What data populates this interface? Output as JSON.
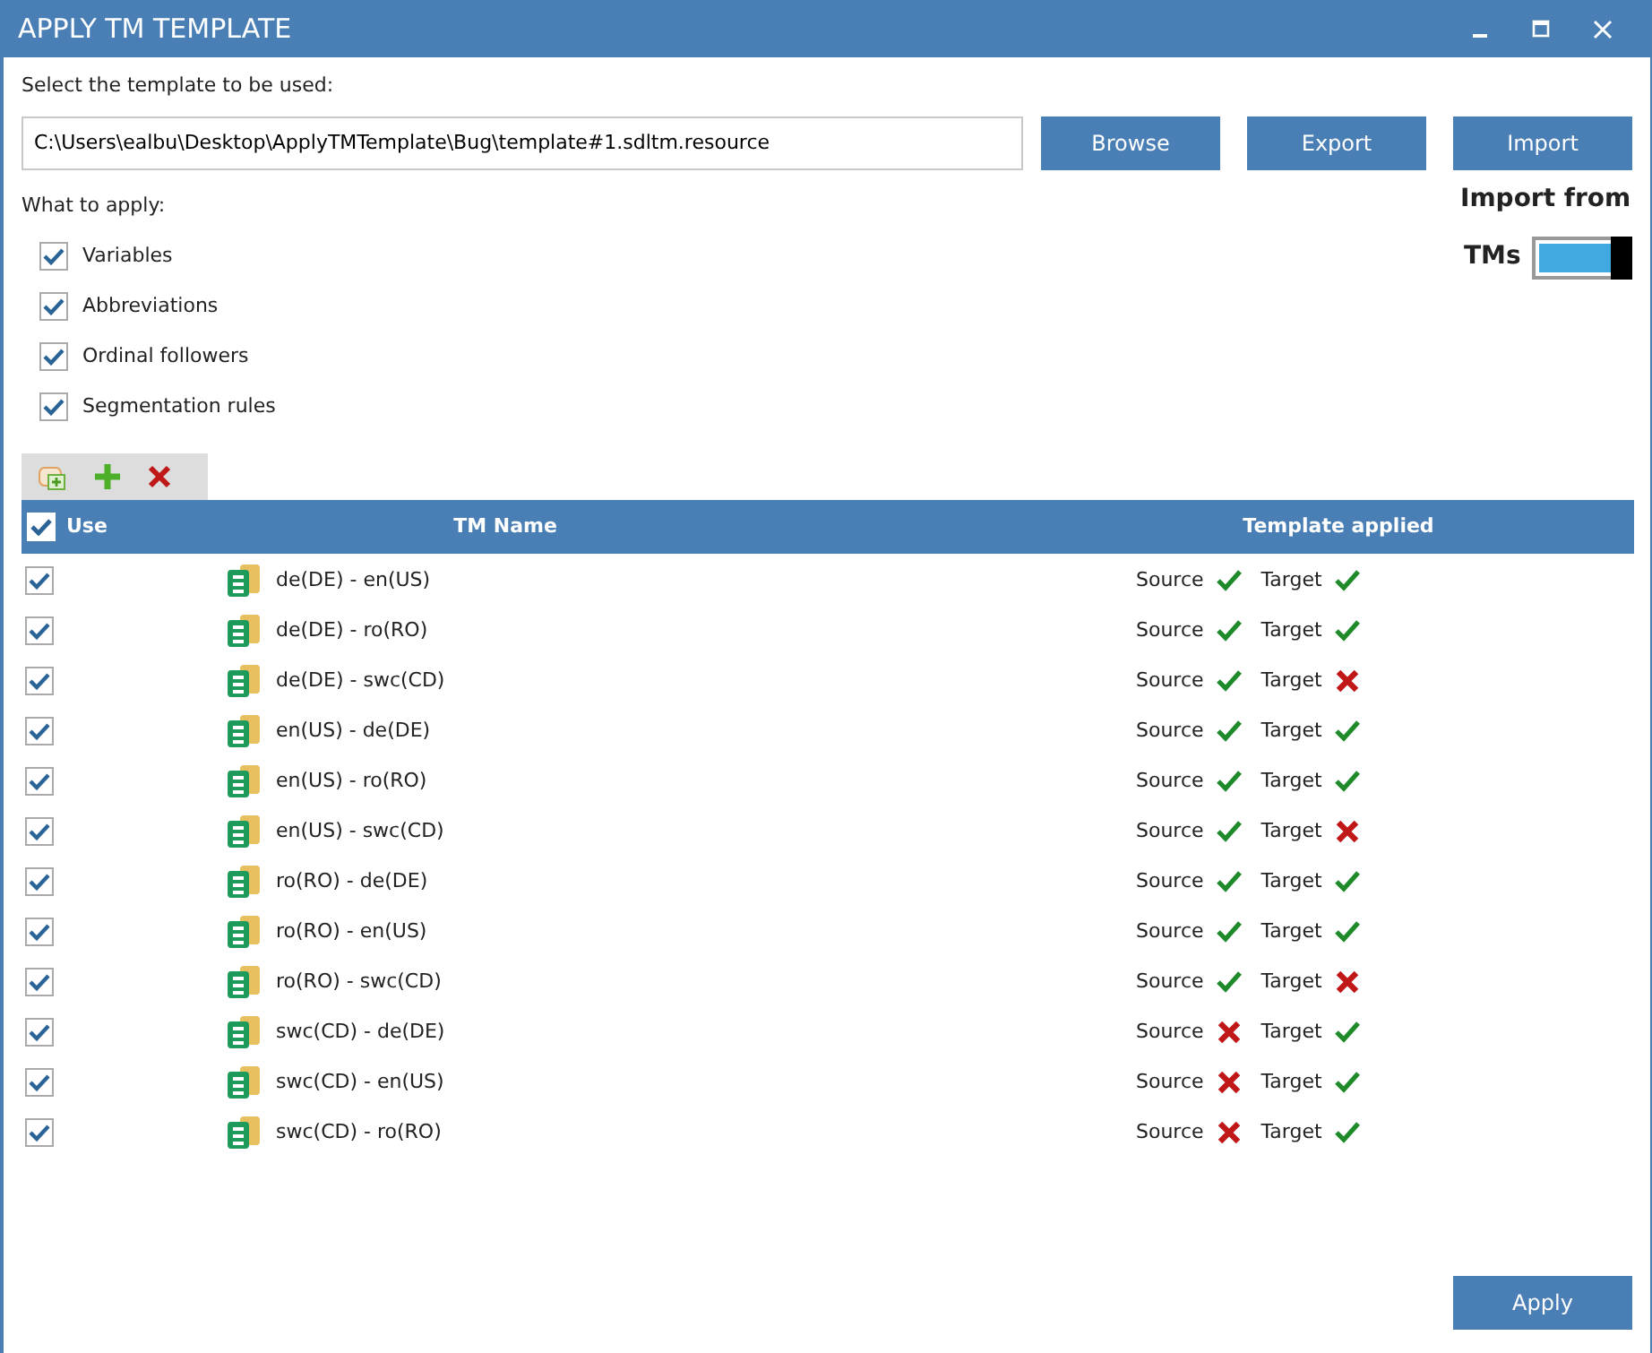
{
  "window": {
    "title": "APPLY TM TEMPLATE"
  },
  "template": {
    "label": "Select the template to be used:",
    "value": "C:\\Users\\ealbu\\Desktop\\ApplyTMTemplate\\Bug\\template#1.sdltm.resource",
    "buttons": [
      "Browse",
      "Export",
      "Import"
    ]
  },
  "import_toggle": {
    "label": "Import from",
    "label_continued": "TMs",
    "on": true
  },
  "apply": {
    "label": "What to apply:",
    "options": [
      {
        "label": "Variables",
        "checked": true
      },
      {
        "label": "Abbreviations",
        "checked": true
      },
      {
        "label": "Ordinal followers",
        "checked": true
      },
      {
        "label": "Segmentation rules",
        "checked": true
      }
    ]
  },
  "table": {
    "columns": [
      "Use",
      "TM Name",
      "Template applied"
    ],
    "all_checked": true,
    "rows": [
      {
        "checked": true,
        "name": "de(DE) - en(US)",
        "source_label": "Source",
        "source_ok": true,
        "target_label": "Target",
        "target_ok": true
      },
      {
        "checked": true,
        "name": "de(DE) - ro(RO)",
        "source_label": "Source",
        "source_ok": true,
        "target_label": "Target",
        "target_ok": true
      },
      {
        "checked": true,
        "name": "de(DE) - swc(CD)",
        "source_label": "Source",
        "source_ok": true,
        "target_label": "Target",
        "target_ok": false
      },
      {
        "checked": true,
        "name": "en(US) - de(DE)",
        "source_label": "Source",
        "source_ok": true,
        "target_label": "Target",
        "target_ok": true
      },
      {
        "checked": true,
        "name": "en(US) - ro(RO)",
        "source_label": "Source",
        "source_ok": true,
        "target_label": "Target",
        "target_ok": true
      },
      {
        "checked": true,
        "name": "en(US) - swc(CD)",
        "source_label": "Source",
        "source_ok": true,
        "target_label": "Target",
        "target_ok": false
      },
      {
        "checked": true,
        "name": "ro(RO) - de(DE)",
        "source_label": "Source",
        "source_ok": true,
        "target_label": "Target",
        "target_ok": true
      },
      {
        "checked": true,
        "name": "ro(RO) - en(US)",
        "source_label": "Source",
        "source_ok": true,
        "target_label": "Target",
        "target_ok": true
      },
      {
        "checked": true,
        "name": "ro(RO) - swc(CD)",
        "source_label": "Source",
        "source_ok": true,
        "target_label": "Target",
        "target_ok": false
      },
      {
        "checked": true,
        "name": "swc(CD) - de(DE)",
        "source_label": "Source",
        "source_ok": false,
        "target_label": "Target",
        "target_ok": true
      },
      {
        "checked": true,
        "name": "swc(CD) - en(US)",
        "source_label": "Source",
        "source_ok": false,
        "target_label": "Target",
        "target_ok": true
      },
      {
        "checked": true,
        "name": "swc(CD) - ro(RO)",
        "source_label": "Source",
        "source_ok": false,
        "target_label": "Target",
        "target_ok": true
      }
    ]
  },
  "footer_button": "Apply"
}
